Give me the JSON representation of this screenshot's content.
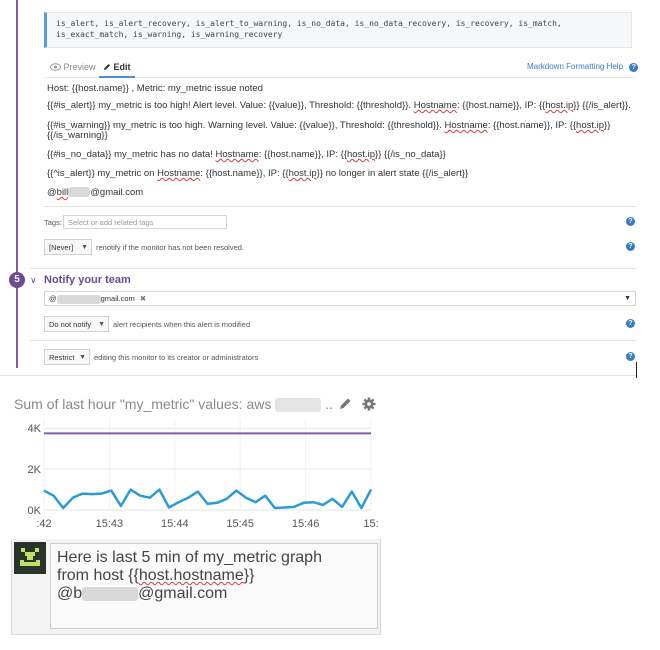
{
  "step": {
    "number": "5",
    "title": "Notify your team"
  },
  "variables": "is_alert, is_alert_recovery, is_alert_to_warning, is_no_data, is_no_data_recovery, is_recovery, is_match, is_exact_match, is_warning, is_warning_recovery",
  "editor": {
    "tabs": {
      "preview": "Preview",
      "edit": "Edit"
    },
    "markdown_help": "Markdown Formatting Help",
    "lines": {
      "l1": "Host: {{host.name}} , Metric: my_metric issue noted",
      "l2a": "{{#is_alert}} my_metric is too high!  Alert level. Value: {{value}},  Threshold: {{threshold}}. ",
      "l2_host": "Hostname",
      "l2b": ": {{host.name}}, IP: {{",
      "l2_ip": "host.ip",
      "l2c": "}} {{/is_alert}}.",
      "l3a": "{{#is_warning}} my_metric is too high.  Warning level. Value: {{value}},  Threshold: {{threshold}}. ",
      "l3_host": "Hostname",
      "l3b": ": {{host.name}}, IP: {{",
      "l3_ip": "host.ip",
      "l3c": "}}",
      "l3d": "{{/is_warning}}",
      "l4a": "{{#is_no_data}} my_metric  has no data! ",
      "l4_host": "Hostname",
      "l4b": ": {{host.name}}, IP: {{",
      "l4_ip": "host.ip",
      "l4c": "}} {{/is_no_data}}",
      "l5a": "{{^is_alert}}  my_metric on ",
      "l5_host": "Hostname",
      "l5b": ": {{host.name}}, IP: {{",
      "l5_ip": "host.ip",
      "l5c": "}} no longer in alert state {{/is_alert}}",
      "l6a": "@",
      "l6_bill": "bill",
      "l6b": "@gmail.com"
    }
  },
  "tags": {
    "label": "Tags:",
    "placeholder": "Select or add related tags"
  },
  "renotify": {
    "value": "[Never]",
    "text": "renotify if the monitor has not been resolved."
  },
  "recipients": {
    "prefix": "@",
    "suffix": "gmail.com"
  },
  "notify_modified": {
    "value": "Do not notify",
    "text": "alert recipients when this alert is modified"
  },
  "restrict": {
    "value": "Restrict",
    "text": "editing this monitor to its creator or administrators"
  },
  "chart": {
    "title_prefix": "Sum of last hour \"my_metric\" values: aws",
    "title_suffix": "..",
    "accent_line": "#7e5ca8",
    "line_color": "#2b9bd8"
  },
  "chart_data": {
    "type": "line",
    "title": "Sum of last hour \"my_metric\" values: aws ..",
    "yticks": [
      "4K",
      "2K",
      "0K"
    ],
    "xticks": [
      ":42",
      "15:43",
      "15:44",
      "15:45",
      "15:46",
      "15:"
    ],
    "ylim": [
      0,
      4500
    ],
    "threshold": 3750,
    "series": [
      {
        "values": [
          950,
          700,
          100,
          600,
          800,
          780,
          800,
          950,
          200,
          1000,
          700,
          600,
          1000,
          120,
          380,
          600,
          900,
          300,
          350,
          550,
          950,
          600,
          380,
          700,
          100,
          120,
          150,
          350,
          380,
          250,
          550,
          150,
          900,
          100,
          1000
        ]
      }
    ]
  },
  "message": {
    "line1": "Here is last 5 min of my_metric graph",
    "line2a": "from host {{",
    "line2_host": "host.hostname",
    "line2b": "}}",
    "line3a": "@b",
    "line3b": "@gmail.com"
  }
}
